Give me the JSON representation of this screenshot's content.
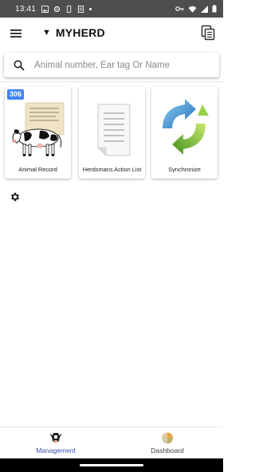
{
  "status_bar": {
    "time": "13:41",
    "icons_left": [
      "photo-icon",
      "settings-icon",
      "phone-icon",
      "document-icon",
      "dot-icon"
    ],
    "icons_right": [
      "key-icon",
      "wifi-icon",
      "signal-icon",
      "battery-icon"
    ]
  },
  "appbar": {
    "caret": "▼",
    "herd_title": "MYHERD"
  },
  "search": {
    "placeholder": "Animal number, Ear tag Or Name",
    "value": ""
  },
  "tiles": [
    {
      "label": "Animal Record",
      "badge": "306",
      "icon": "cow-record-icon"
    },
    {
      "label": "Herdsmans Action List",
      "icon": "document-list-icon"
    },
    {
      "label": "Synchronize",
      "icon": "sync-arrows-icon"
    }
  ],
  "bottom_nav": [
    {
      "label": "Management",
      "icon": "cow-head-icon",
      "active": true
    },
    {
      "label": "Dashboard",
      "icon": "pie-chart-icon",
      "active": false
    }
  ],
  "colors": {
    "status_bar": "#4e4e4e",
    "accent": "#3f51b5",
    "badge": "#4285f4"
  }
}
